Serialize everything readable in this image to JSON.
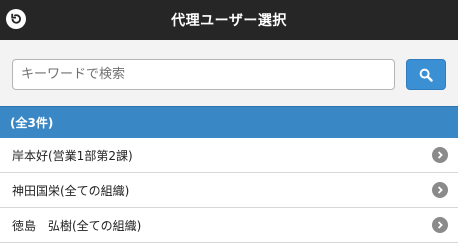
{
  "header": {
    "title": "代理ユーザー選択",
    "back_icon": "back-arrow-icon"
  },
  "search": {
    "placeholder": "キーワードで検索",
    "value": "",
    "button_icon": "search-icon"
  },
  "results": {
    "count_label": "(全3件)",
    "items": [
      {
        "label": "岸本好(営業1部第2課)"
      },
      {
        "label": "神田国栄(全ての組織)"
      },
      {
        "label": "徳島　弘樹(全ての組織)"
      }
    ],
    "item_icon": "chevron-right-icon"
  },
  "colors": {
    "header_bg": "#262626",
    "search_area_bg": "#f3f3f3",
    "accent": "#3b8fd3",
    "count_bar_bg": "#3a87c6",
    "chevron": "#8a8a8a"
  }
}
